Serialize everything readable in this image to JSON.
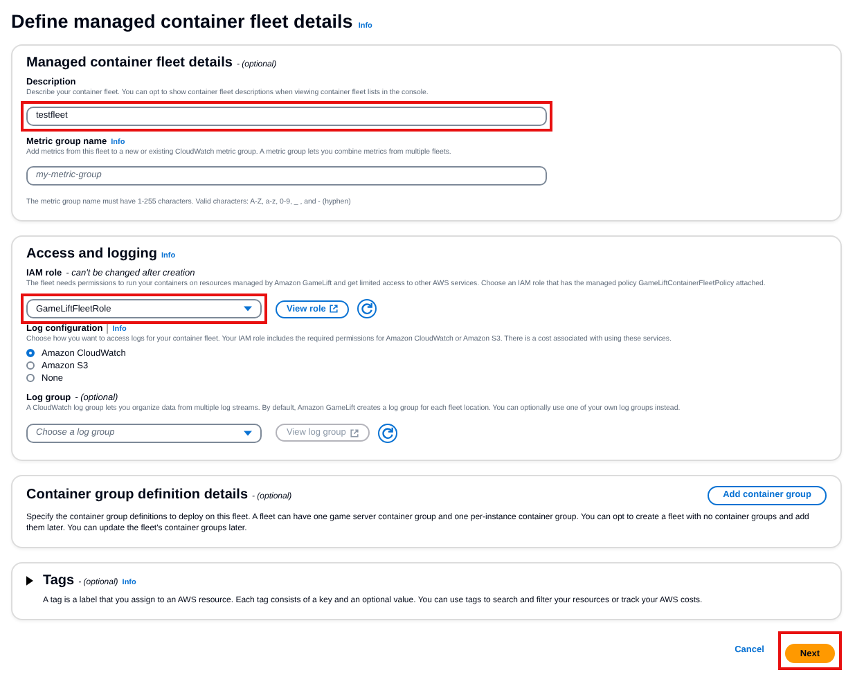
{
  "page": {
    "title": "Define managed container fleet details",
    "info": "Info"
  },
  "details": {
    "title": "Managed container fleet details",
    "optional": "- (optional)",
    "description": {
      "label": "Description",
      "hint": "Describe your container fleet. You can opt to show container fleet descriptions when viewing container fleet lists in the console.",
      "value": "testfleet",
      "highlighted": true
    },
    "metric": {
      "label": "Metric group name",
      "info": "Info",
      "hint": "Add metrics from this fleet to a new or existing CloudWatch metric group. A metric group lets you combine metrics from multiple fleets.",
      "placeholder": "my-metric-group",
      "constraint": "The metric group name must have 1-255 characters. Valid characters: A-Z, a-z, 0-9, _ , and - (hyphen)"
    }
  },
  "access": {
    "title": "Access and logging",
    "info": "Info",
    "iam": {
      "label": "IAM role",
      "note": "- can't be changed after creation",
      "hint": "The fleet needs permissions to run your containers on resources managed by Amazon GameLift and get limited access to other AWS services. Choose an IAM role that has the managed policy GameLiftContainerFleetPolicy attached.",
      "value": "GameLiftFleetRole",
      "highlighted": true,
      "view": "View role",
      "view_disabled": false
    },
    "log_config": {
      "label": "Log configuration",
      "info": "Info",
      "hint": "Choose how you want to access logs for your container fleet. Your IAM role includes the required permissions for Amazon CloudWatch or Amazon S3. There is a cost associated with using these services.",
      "options": [
        {
          "label": "Amazon CloudWatch",
          "selected": true
        },
        {
          "label": "Amazon S3",
          "selected": false
        },
        {
          "label": "None",
          "selected": false
        }
      ]
    },
    "log_group": {
      "label": "Log group",
      "optional": "- (optional)",
      "hint": "A CloudWatch log group lets you organize data from multiple log streams. By default, Amazon GameLift creates a log group for each fleet location. You can optionally use one of your own log groups instead.",
      "placeholder": "Choose a log group",
      "view": "View log group",
      "view_disabled": true
    }
  },
  "container_groups": {
    "title": "Container group definition details",
    "optional": "- (optional)",
    "button": "Add container group",
    "text": "Specify the container group definitions to deploy on this fleet. A fleet can have one game server container group and one per-instance container group. You can opt to create a fleet with no container groups and add them later. You can update the fleet's container groups later."
  },
  "tags": {
    "title": "Tags",
    "optional": "- (optional)",
    "info": "Info",
    "expanded": false,
    "text": "A tag is a label that you assign to an AWS resource. Each tag consists of a key and an optional value. You can use tags to search and filter your resources or track your AWS costs."
  },
  "footer": {
    "cancel": "Cancel",
    "next": "Next",
    "next_highlighted": true
  }
}
